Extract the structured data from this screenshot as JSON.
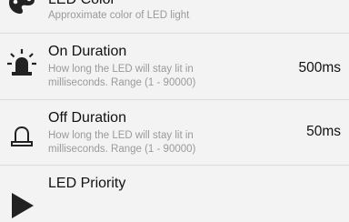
{
  "settings": {
    "items": [
      {
        "title": "LED Color",
        "summary": "Approximate color of LED light",
        "icon": "palette-icon"
      },
      {
        "title": "On Duration",
        "summary": "How long the LED will stay lit in milliseconds. Range (1 - 90000)",
        "value": "500ms",
        "icon": "led-on-icon"
      },
      {
        "title": "Off Duration",
        "summary": "How long the LED will stay lit in milliseconds. Range (1 - 90000)",
        "value": "50ms",
        "icon": "led-off-icon"
      },
      {
        "title": "LED Priority",
        "icon": "priority-arrow-icon"
      }
    ]
  },
  "colors": {
    "background": "#f3f3f3",
    "divider": "#dcdcdc",
    "title": "#111111",
    "summary": "#9a9a9a",
    "icon": "#222222"
  }
}
